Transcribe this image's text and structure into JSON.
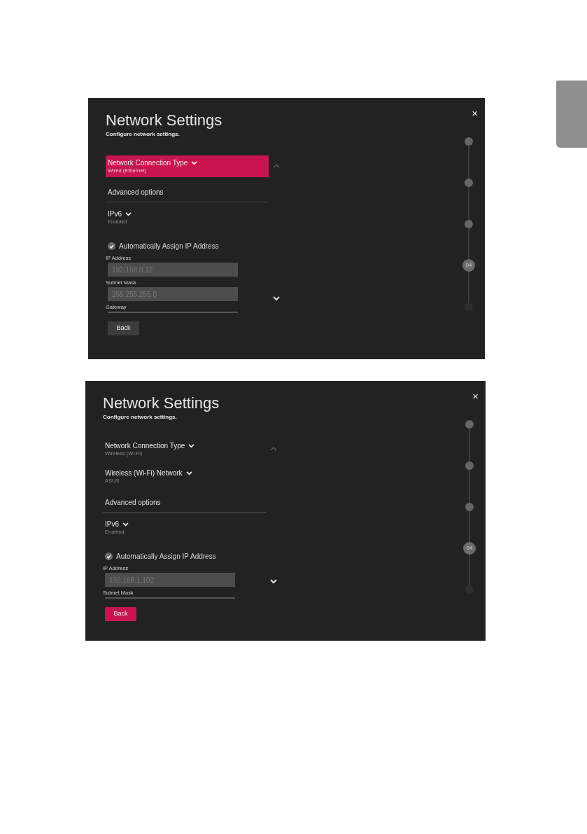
{
  "screens": [
    {
      "title": "Network Settings",
      "subtitle": "Configure network settings.",
      "close": "×",
      "items": [
        {
          "kind": "dropdown",
          "label": "Network Connection Type",
          "value": "Wired (Ethernet)",
          "focused": true
        },
        {
          "kind": "section",
          "label": "Advanced options"
        },
        {
          "kind": "dropdown",
          "label": "IPv6",
          "value": "Enabled",
          "focused": false
        },
        {
          "kind": "checkbox",
          "label": "Automatically Assign IP Address",
          "checked": true
        },
        {
          "kind": "field",
          "label": "IP Address",
          "value": "192.168.0.12",
          "disabled": true
        },
        {
          "kind": "field",
          "label": "Subnet Mask",
          "value": "255.255.255.0",
          "disabled": true
        },
        {
          "kind": "field_cut",
          "label": "Gateway"
        }
      ],
      "back": {
        "label": "Back",
        "focused": false
      },
      "steps": [
        {
          "reached": true,
          "current": false
        },
        {
          "reached": true,
          "current": false
        },
        {
          "reached": true,
          "current": false
        },
        {
          "reached": true,
          "current": true,
          "label": "04"
        },
        {
          "reached": false,
          "current": false
        }
      ]
    },
    {
      "title": "Network Settings",
      "subtitle": "Configure network settings.",
      "close": "×",
      "items": [
        {
          "kind": "dropdown",
          "label": "Network Connection Type",
          "value": "Wireless (Wi-Fi)",
          "focused": false
        },
        {
          "kind": "dropdown",
          "label": "Wireless (Wi-Fi) Network",
          "value": "ASUS",
          "focused": false
        },
        {
          "kind": "section",
          "label": "Advanced options"
        },
        {
          "kind": "dropdown",
          "label": "IPv6",
          "value": "Enabled",
          "focused": false
        },
        {
          "kind": "checkbox",
          "label": "Automatically Assign IP Address",
          "checked": true
        },
        {
          "kind": "field",
          "label": "IP Address",
          "value": "192.168.1.102",
          "disabled": true
        },
        {
          "kind": "field_cut",
          "label": "Subnet Mask"
        }
      ],
      "back": {
        "label": "Back",
        "focused": true
      },
      "steps": [
        {
          "reached": true,
          "current": false
        },
        {
          "reached": true,
          "current": false
        },
        {
          "reached": true,
          "current": false
        },
        {
          "reached": true,
          "current": true,
          "label": "04"
        },
        {
          "reached": false,
          "current": false
        }
      ]
    }
  ]
}
